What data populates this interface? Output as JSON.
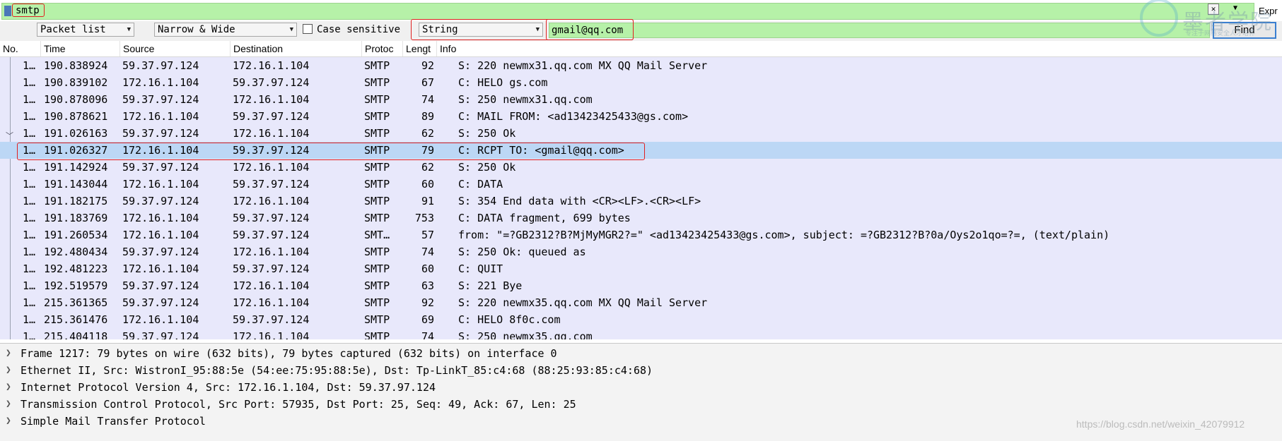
{
  "filter": {
    "value": "smtp",
    "expression_label": "Expr"
  },
  "find_bar": {
    "search_in": "Packet list",
    "char_width": "Narrow & Wide",
    "case_sensitive_label": "Case sensitive",
    "search_type": "String",
    "search_value": "gmail@qq.com",
    "find_button": "Find"
  },
  "watermark": {
    "title": "墨者学院",
    "subtitle": "专注于网络安全人才培养"
  },
  "columns": [
    "No.",
    "Time",
    "Source",
    "Destination",
    "Protoc",
    "Lengt",
    "Info"
  ],
  "packets": [
    {
      "no": "1…",
      "time": "190.838924",
      "src": "59.37.97.124",
      "dst": "172.16.1.104",
      "proto": "SMTP",
      "len": "92",
      "info": "S: 220 newmx31.qq.com MX QQ Mail Server"
    },
    {
      "no": "1…",
      "time": "190.839102",
      "src": "172.16.1.104",
      "dst": "59.37.97.124",
      "proto": "SMTP",
      "len": "67",
      "info": "C: HELO gs.com"
    },
    {
      "no": "1…",
      "time": "190.878096",
      "src": "59.37.97.124",
      "dst": "172.16.1.104",
      "proto": "SMTP",
      "len": "74",
      "info": "S: 250 newmx31.qq.com"
    },
    {
      "no": "1…",
      "time": "190.878621",
      "src": "172.16.1.104",
      "dst": "59.37.97.124",
      "proto": "SMTP",
      "len": "89",
      "info": "C: MAIL FROM: <ad13423425433@gs.com>"
    },
    {
      "no": "1…",
      "time": "191.026163",
      "src": "59.37.97.124",
      "dst": "172.16.1.104",
      "proto": "SMTP",
      "len": "62",
      "info": "S: 250 Ok"
    },
    {
      "no": "1…",
      "time": "191.026327",
      "src": "172.16.1.104",
      "dst": "59.37.97.124",
      "proto": "SMTP",
      "len": "79",
      "info": "C: RCPT TO: <gmail@qq.com>",
      "selected": true
    },
    {
      "no": "1…",
      "time": "191.142924",
      "src": "59.37.97.124",
      "dst": "172.16.1.104",
      "proto": "SMTP",
      "len": "62",
      "info": "S: 250 Ok"
    },
    {
      "no": "1…",
      "time": "191.143044",
      "src": "172.16.1.104",
      "dst": "59.37.97.124",
      "proto": "SMTP",
      "len": "60",
      "info": "C: DATA"
    },
    {
      "no": "1…",
      "time": "191.182175",
      "src": "59.37.97.124",
      "dst": "172.16.1.104",
      "proto": "SMTP",
      "len": "91",
      "info": "S: 354 End data with <CR><LF>.<CR><LF>"
    },
    {
      "no": "1…",
      "time": "191.183769",
      "src": "172.16.1.104",
      "dst": "59.37.97.124",
      "proto": "SMTP",
      "len": "753",
      "info": "C: DATA fragment, 699 bytes"
    },
    {
      "no": "1…",
      "time": "191.260534",
      "src": "172.16.1.104",
      "dst": "59.37.97.124",
      "proto": "SMT…",
      "len": "57",
      "info": "from: \"=?GB2312?B?MjMyMGR2?=\" <ad13423425433@gs.com>, subject: =?GB2312?B?0a/Oys2o1qo=?=,  (text/plain)"
    },
    {
      "no": "1…",
      "time": "192.480434",
      "src": "59.37.97.124",
      "dst": "172.16.1.104",
      "proto": "SMTP",
      "len": "74",
      "info": "S: 250 Ok: queued as"
    },
    {
      "no": "1…",
      "time": "192.481223",
      "src": "172.16.1.104",
      "dst": "59.37.97.124",
      "proto": "SMTP",
      "len": "60",
      "info": "C: QUIT"
    },
    {
      "no": "1…",
      "time": "192.519579",
      "src": "59.37.97.124",
      "dst": "172.16.1.104",
      "proto": "SMTP",
      "len": "63",
      "info": "S: 221 Bye"
    },
    {
      "no": "1…",
      "time": "215.361365",
      "src": "59.37.97.124",
      "dst": "172.16.1.104",
      "proto": "SMTP",
      "len": "92",
      "info": "S: 220 newmx35.qq.com MX QQ Mail Server"
    },
    {
      "no": "1…",
      "time": "215.361476",
      "src": "172.16.1.104",
      "dst": "59.37.97.124",
      "proto": "SMTP",
      "len": "69",
      "info": "C: HELO 8f0c.com"
    },
    {
      "no": "1…",
      "time": "215.404118",
      "src": "59.37.97.124",
      "dst": "172.16.1.104",
      "proto": "SMTP",
      "len": "74",
      "info": "S: 250 newmx35.qq.com"
    }
  ],
  "details": [
    "Frame 1217: 79 bytes on wire (632 bits), 79 bytes captured (632 bits) on interface 0",
    "Ethernet II, Src: WistronI_95:88:5e (54:ee:75:95:88:5e), Dst: Tp-LinkT_85:c4:68 (88:25:93:85:c4:68)",
    "Internet Protocol Version 4, Src: 172.16.1.104, Dst: 59.37.97.124",
    "Transmission Control Protocol, Src Port: 57935, Dst Port: 25, Seq: 49, Ack: 67, Len: 25",
    "Simple Mail Transfer Protocol"
  ],
  "source_watermark": "https://blog.csdn.net/weixin_42079912",
  "colors": {
    "filter_green": "#b6f1a8",
    "row_bg": "#e8e8fb",
    "selected_row": "#bcd7f5",
    "highlight_red": "#e02020"
  }
}
